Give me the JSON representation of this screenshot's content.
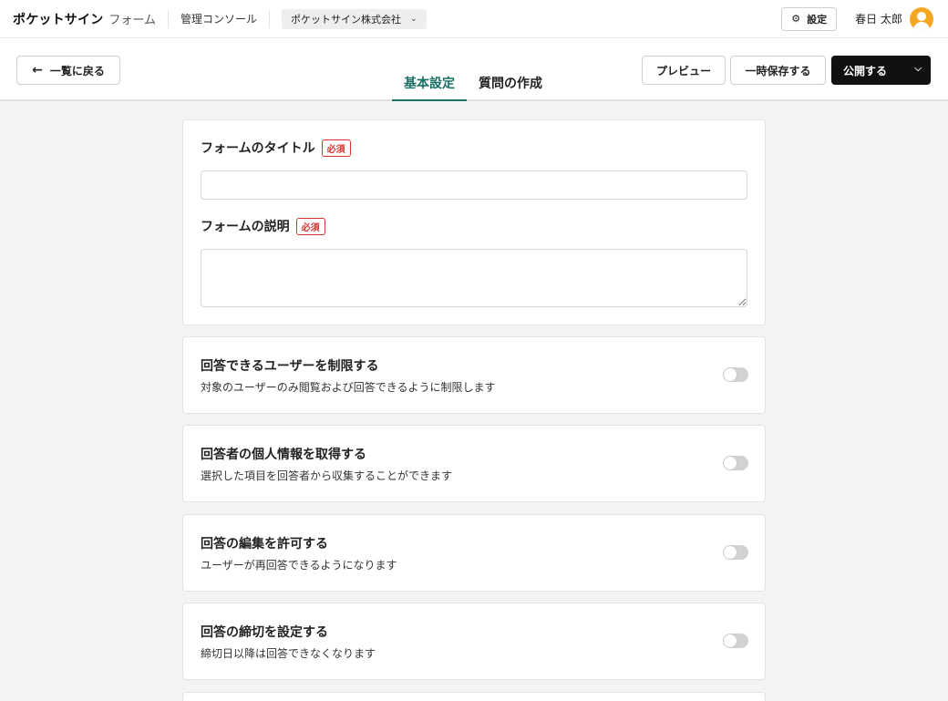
{
  "header": {
    "brand_name": "ポケットサイン",
    "brand_product": "フォーム",
    "console_link": "管理コンソール",
    "org_selector": "ポケットサイン株式会社",
    "settings_label": "設定",
    "user_name": "春日 太郎"
  },
  "toolbar": {
    "back_label": "一覧に戻る",
    "tabs": [
      {
        "label": "基本設定",
        "active": true
      },
      {
        "label": "質問の作成",
        "active": false
      }
    ],
    "preview_label": "プレビュー",
    "save_label": "一時保存する",
    "publish_label": "公開する"
  },
  "form": {
    "title_label": "フォームのタイトル",
    "title_value": "",
    "description_label": "フォームの説明",
    "description_value": "",
    "required_badge": "必須"
  },
  "settings": [
    {
      "title": "回答できるユーザーを制限する",
      "description": "対象のユーザーのみ閲覧および回答できるように制限します",
      "enabled": false
    },
    {
      "title": "回答者の個人情報を取得する",
      "description": "選択した項目を回答者から収集することができます",
      "enabled": false
    },
    {
      "title": "回答の編集を許可する",
      "description": "ユーザーが再回答できるようになります",
      "enabled": false
    },
    {
      "title": "回答の締切を設定する",
      "description": "締切日以降は回答できなくなります",
      "enabled": false
    }
  ],
  "colors": {
    "accent": "#1a6f66",
    "required": "#d9332f",
    "primary_button": "#111111",
    "avatar": "#f5a623"
  },
  "icons": {
    "back": "arrow-left-icon",
    "settings": "gear-icon",
    "dropdown": "chevron-down-icon",
    "user": "user-avatar-icon"
  }
}
